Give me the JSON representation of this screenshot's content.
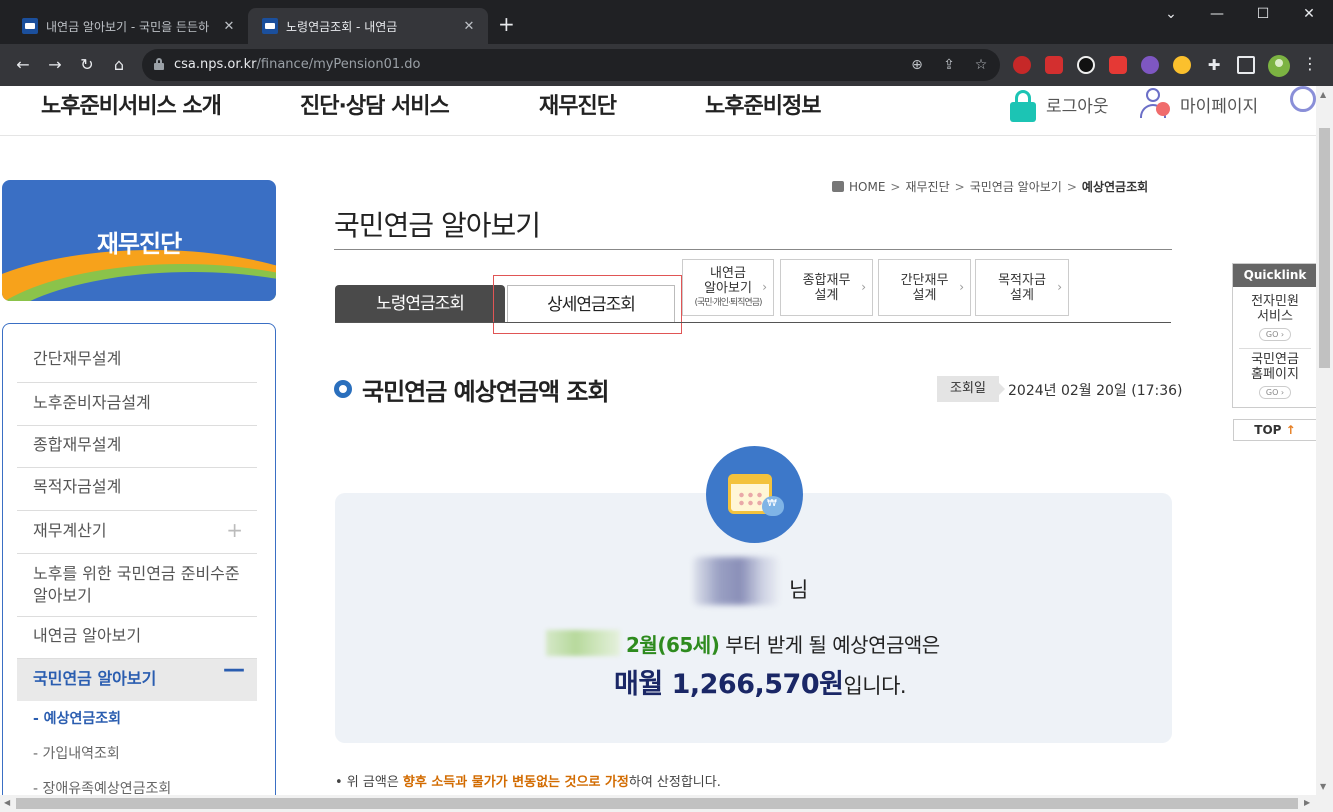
{
  "browser": {
    "tabs": [
      {
        "title": "내연금 알아보기 - 국민을 든든하",
        "active": false
      },
      {
        "title": "노령연금조회 - 내연금",
        "active": true
      }
    ],
    "url_host": "csa.nps.or.kr",
    "url_path": "/finance/myPension01.do"
  },
  "gnb": {
    "items": [
      "노후준비서비스 소개",
      "진단·상담 서비스",
      "재무진단",
      "노후준비정보"
    ],
    "logout": "로그아웃",
    "mypage": "마이페이지"
  },
  "sidebar": {
    "banner_title": "재무진단",
    "items": [
      {
        "label": "간단재무설계"
      },
      {
        "label": "노후준비자금설계"
      },
      {
        "label": "종합재무설계"
      },
      {
        "label": "목적자금설계"
      },
      {
        "label": "재무계산기"
      },
      {
        "label": "노후를 위한 국민연금 준비수준 알아보기"
      },
      {
        "label": "내연금 알아보기"
      },
      {
        "label": "국민연금 알아보기"
      }
    ],
    "sub_items": [
      {
        "label": "- 예상연금조회"
      },
      {
        "label": "- 가입내역조회"
      },
      {
        "label": "- 장애유족예상연금조회"
      }
    ]
  },
  "breadcrumb": [
    "HOME",
    "재무진단",
    "국민연금 알아보기",
    "예상연금조회"
  ],
  "page_title": "국민연금 알아보기",
  "tabs": {
    "main": [
      "노령연금조회",
      "상세연금조회"
    ],
    "small": [
      {
        "line1": "내연금",
        "line2": "알아보기",
        "line3": "(국민·개인·퇴직연금)"
      },
      {
        "line1": "종합재무",
        "line2": "설계"
      },
      {
        "line1": "간단재무",
        "line2": "설계"
      },
      {
        "line1": "목적자금",
        "line2": "설계"
      }
    ]
  },
  "section": {
    "title": "국민연금 예상연금액 조회",
    "date_label": "조회일",
    "date_value": "2024년 02월 20일 (17:36)"
  },
  "result": {
    "name_suffix": "님",
    "start": "2월(65세)",
    "text1": " 부터 받게 될 예상연금액은",
    "amount": "매월 1,266,570원",
    "tail": "입니다."
  },
  "note": {
    "bullet": "• 위 금액은 ",
    "highlight": "향후 소득과 물가가 변동없는 것으로 가정",
    "rest": "하여 산정합니다."
  },
  "quicklink": {
    "title": "Quicklink",
    "items": [
      {
        "line1": "전자민원",
        "line2": "서비스",
        "go": "GO ›"
      },
      {
        "line1": "국민연금",
        "line2": "홈페이지",
        "go": "GO ›"
      }
    ],
    "top": "TOP"
  }
}
